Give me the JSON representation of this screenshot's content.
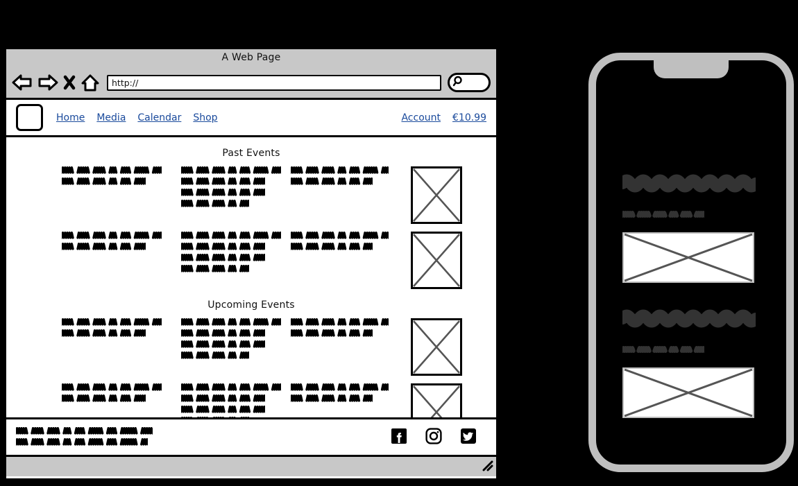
{
  "browser": {
    "title": "A Web Page",
    "url_value": "http://",
    "url_placeholder": "http://",
    "nav_icons": [
      "back-arrow-icon",
      "forward-arrow-icon",
      "stop-x-icon",
      "home-icon"
    ],
    "search_icon": "magnifier-icon",
    "resize_grip": "resize-grip-icon"
  },
  "site_header": {
    "logo": "logo-placeholder",
    "nav": [
      {
        "label": "Home"
      },
      {
        "label": "Media"
      },
      {
        "label": "Calendar"
      },
      {
        "label": "Shop"
      }
    ],
    "account_label": "Account",
    "price_label": "€10.99",
    "link_color": "#1a4a9c"
  },
  "content": {
    "sections": [
      {
        "title": "Past Events",
        "rows": [
          {
            "columns": [
              {
                "lines": [
                  32,
                  27
                ]
              },
              {
                "lines": [
                  32,
                  27,
                  27,
                  22
                ]
              },
              {
                "lines": [
                  31,
                  26
                ]
              }
            ],
            "image": "image-placeholder"
          },
          {
            "columns": [
              {
                "lines": [
                  32,
                  27
                ]
              },
              {
                "lines": [
                  32,
                  27,
                  27,
                  22
                ]
              },
              {
                "lines": [
                  31,
                  26
                ]
              }
            ],
            "image": "image-placeholder"
          }
        ]
      },
      {
        "title": "Upcoming Events",
        "rows": [
          {
            "columns": [
              {
                "lines": [
                  32,
                  27
                ]
              },
              {
                "lines": [
                  32,
                  27,
                  27,
                  22
                ]
              },
              {
                "lines": [
                  31,
                  26
                ]
              }
            ],
            "image": "image-placeholder"
          },
          {
            "columns": [
              {
                "lines": [
                  32,
                  27
                ]
              },
              {
                "lines": [
                  32,
                  27,
                  27,
                  22
                ]
              },
              {
                "lines": [
                  31,
                  26
                ]
              }
            ],
            "image": "image-placeholder"
          }
        ]
      }
    ]
  },
  "site_footer": {
    "text_lines": [
      44,
      42
    ],
    "social": [
      {
        "name": "facebook-icon"
      },
      {
        "name": "instagram-icon"
      },
      {
        "name": "twitter-icon"
      }
    ]
  },
  "phone": {
    "notch": "phone-notch",
    "bezel_color": "#bfbfbf",
    "screen_color": "#000000",
    "scribble_color": "#333333",
    "blocks": [
      {
        "heading_units": 16,
        "sub_units": 26,
        "image": "image-placeholder"
      },
      {
        "heading_units": 16,
        "sub_units": 26,
        "image": "image-placeholder"
      }
    ]
  }
}
